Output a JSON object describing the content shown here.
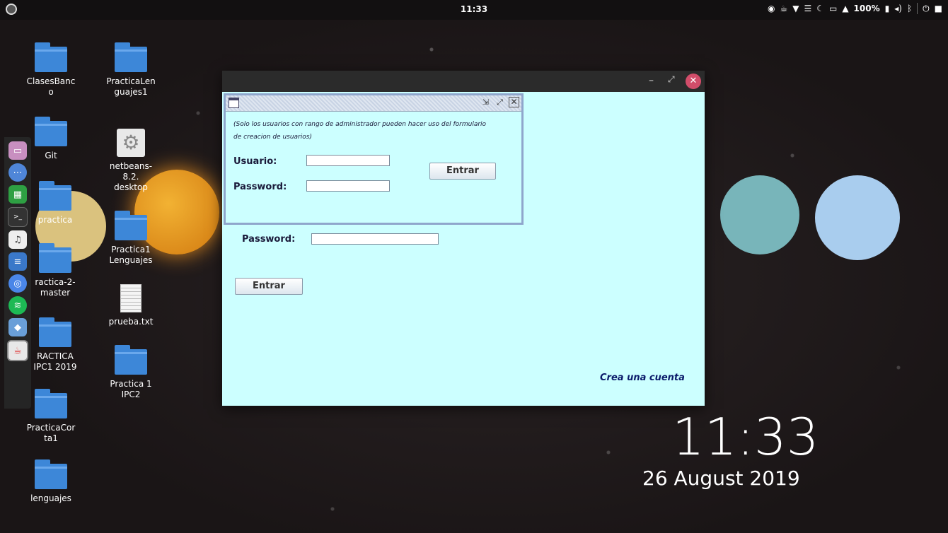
{
  "top_panel": {
    "clock": "11:33",
    "battery": "100%"
  },
  "desktop": {
    "icons": [
      {
        "label": "ClasesBanc\no",
        "kind": "folder"
      },
      {
        "label": "PracticaLen\nguajes1",
        "kind": "folder"
      },
      {
        "label": "Git",
        "kind": "folder"
      },
      {
        "label": "netbeans-\n8.2.\ndesktop",
        "kind": "gear"
      },
      {
        "label": "practica",
        "kind": "folder"
      },
      {
        "label": "Practica1\nLenguajes",
        "kind": "folder"
      },
      {
        "label": "ractica-2-\nmaster",
        "kind": "folder"
      },
      {
        "label": "prueba.txt",
        "kind": "text-file"
      },
      {
        "label": "RACTICA\nIPC1 2019",
        "kind": "folder"
      },
      {
        "label": "Practica 1\nIPC2",
        "kind": "folder"
      },
      {
        "label": "PracticaCor\nta1",
        "kind": "folder"
      },
      {
        "label": "lenguajes",
        "kind": "folder"
      }
    ],
    "big_clock": {
      "time": "11:33",
      "date": "26 August 2019"
    }
  },
  "dock": {
    "apps": [
      "files-icon",
      "apps-grid-icon",
      "spreadsheet-icon",
      "terminal-icon",
      "music-icon",
      "text-editor-icon",
      "chrome-icon",
      "spotify-icon",
      "virtualbox-icon",
      "java-icon"
    ]
  },
  "main_window": {
    "password_label": "Password:",
    "password_value": "",
    "entrar_label": "Entrar",
    "crea_cuenta": "Crea una cuenta",
    "internal_frame": {
      "note_line1": "(Solo los usuarios con rango de administrador pueden hacer uso del formulario",
      "note_line2": "de creacion de usuarios)",
      "usuario_label": "Usuario:",
      "usuario_value": "",
      "password_label": "Password:",
      "password_value": "",
      "entrar_label": "Entrar"
    }
  },
  "colors": {
    "window_bg": "#ccffff",
    "panel_bg": "#121011",
    "close_button": "#d24d6a",
    "folder": "#3d87d8"
  }
}
